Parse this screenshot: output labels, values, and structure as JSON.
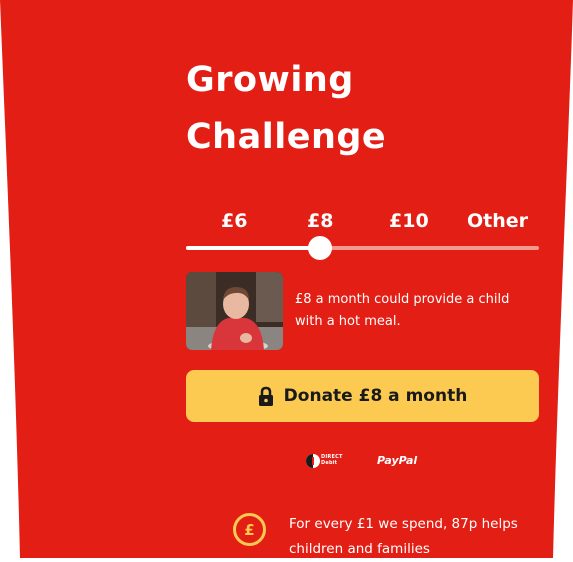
{
  "colors": {
    "panel": "#e31e14",
    "button": "#fcc951",
    "track": "#f39a8f"
  },
  "title": {
    "line1": "Growing",
    "line2": "Challenge"
  },
  "amounts": [
    "£6",
    "£8",
    "£10",
    "Other"
  ],
  "slider": {
    "selected_index": 1,
    "selected_value": "£8"
  },
  "impact_text": "£8 a month could provide a child with a hot meal.",
  "donate": {
    "icon": "lock-icon",
    "label": "Donate £8 a month"
  },
  "payment": {
    "direct_debit_line1": "DIRECT",
    "direct_debit_line2": "Debit",
    "paypal": "PayPal"
  },
  "stat": {
    "icon": "pound-icon",
    "symbol": "£",
    "text": "For every £1 we spend, 87p helps children and families"
  }
}
